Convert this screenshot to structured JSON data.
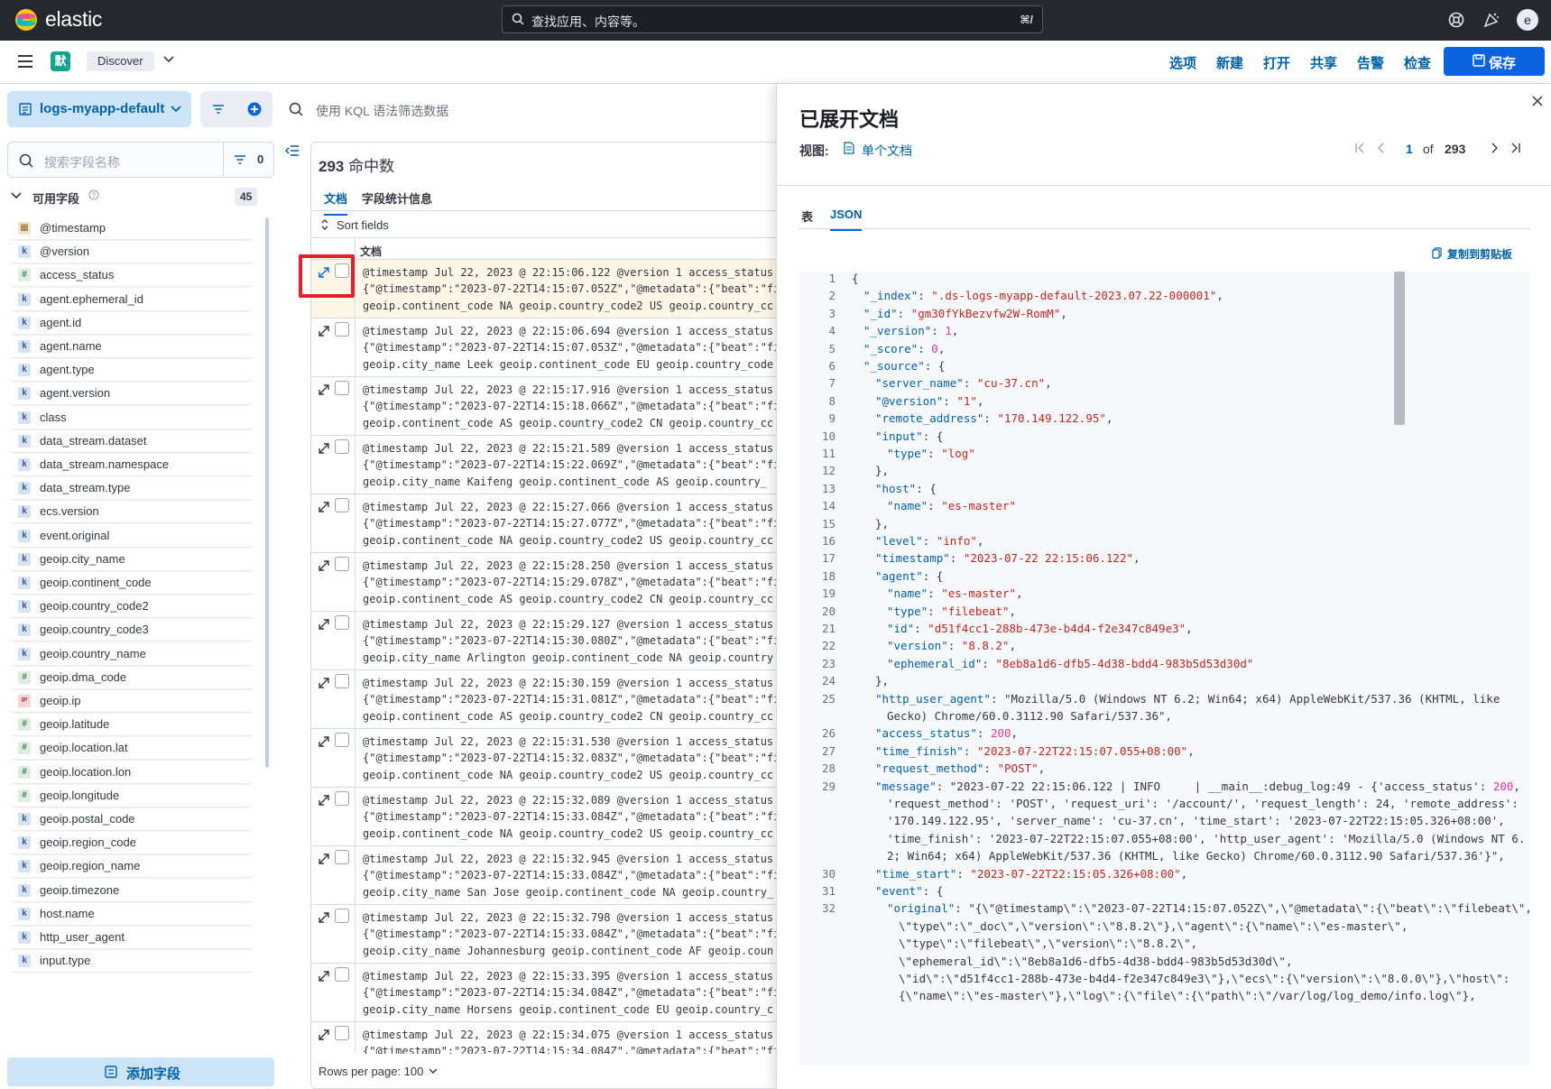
{
  "app": {
    "logo_text": "elastic",
    "search_placeholder": "查找应用、内容等。",
    "search_shortcut": "⌘/",
    "avatar": "e"
  },
  "nav": {
    "space": "默",
    "breadcrumb": "Discover",
    "menu": [
      "选项",
      "新建",
      "打开",
      "共享",
      "告警",
      "检查"
    ],
    "save": "保存"
  },
  "dataview": {
    "name": "logs-myapp-default"
  },
  "kql": {
    "placeholder": "使用 KQL 语法筛选数据"
  },
  "fields": {
    "search_placeholder": "搜索字段名称",
    "filter_count": "0",
    "available_label": "可用字段",
    "available_count": "45",
    "add_label": "添加字段",
    "items": [
      {
        "type": "d",
        "name": "@timestamp"
      },
      {
        "type": "k",
        "name": "@version"
      },
      {
        "type": "n",
        "name": "access_status"
      },
      {
        "type": "k",
        "name": "agent.ephemeral_id"
      },
      {
        "type": "k",
        "name": "agent.id"
      },
      {
        "type": "k",
        "name": "agent.name"
      },
      {
        "type": "k",
        "name": "agent.type"
      },
      {
        "type": "k",
        "name": "agent.version"
      },
      {
        "type": "k",
        "name": "class"
      },
      {
        "type": "k",
        "name": "data_stream.dataset"
      },
      {
        "type": "k",
        "name": "data_stream.namespace"
      },
      {
        "type": "k",
        "name": "data_stream.type"
      },
      {
        "type": "k",
        "name": "ecs.version"
      },
      {
        "type": "k",
        "name": "event.original"
      },
      {
        "type": "k",
        "name": "geoip.city_name"
      },
      {
        "type": "k",
        "name": "geoip.continent_code"
      },
      {
        "type": "k",
        "name": "geoip.country_code2"
      },
      {
        "type": "k",
        "name": "geoip.country_code3"
      },
      {
        "type": "k",
        "name": "geoip.country_name"
      },
      {
        "type": "n",
        "name": "geoip.dma_code"
      },
      {
        "type": "ip",
        "name": "geoip.ip"
      },
      {
        "type": "n",
        "name": "geoip.latitude"
      },
      {
        "type": "n",
        "name": "geoip.location.lat"
      },
      {
        "type": "n",
        "name": "geoip.location.lon"
      },
      {
        "type": "n",
        "name": "geoip.longitude"
      },
      {
        "type": "k",
        "name": "geoip.postal_code"
      },
      {
        "type": "k",
        "name": "geoip.region_code"
      },
      {
        "type": "k",
        "name": "geoip.region_name"
      },
      {
        "type": "k",
        "name": "geoip.timezone"
      },
      {
        "type": "k",
        "name": "host.name"
      },
      {
        "type": "k",
        "name": "http_user_agent"
      },
      {
        "type": "k",
        "name": "input.type"
      }
    ]
  },
  "main": {
    "hits_count": "293",
    "hits_label": "命中数",
    "tab_docs": "文档",
    "tab_stats": "字段统计信息",
    "sort_label": "Sort fields",
    "col_doc": "文档",
    "rows_per_page": "Rows per page: 100",
    "rows": [
      {
        "l1": "@timestamp Jul 22, 2023 @ 22:15:06.122 @version 1 access_status",
        "l2": "{\"@timestamp\":\"2023-07-22T14:15:07.052Z\",\"@metadata\":{\"beat\":\"fi",
        "l3": " geoip.continent_code NA geoip.country_code2 US geoip.country_cc"
      },
      {
        "l1": "@timestamp Jul 22, 2023 @ 22:15:06.694 @version 1 access_status",
        "l2": "{\"@timestamp\":\"2023-07-22T14:15:07.053Z\",\"@metadata\":{\"beat\":\"fi",
        "l3": " geoip.city_name Leek geoip.continent_code EU geoip.country_code"
      },
      {
        "l1": "@timestamp Jul 22, 2023 @ 22:15:17.916 @version 1 access_status",
        "l2": "{\"@timestamp\":\"2023-07-22T14:15:18.066Z\",\"@metadata\":{\"beat\":\"fi",
        "l3": " geoip.continent_code AS geoip.country_code2 CN geoip.country_cc"
      },
      {
        "l1": "@timestamp Jul 22, 2023 @ 22:15:21.589 @version 1 access_status",
        "l2": "{\"@timestamp\":\"2023-07-22T14:15:22.069Z\",\"@metadata\":{\"beat\":\"fi",
        "l3": " geoip.city_name Kaifeng geoip.continent_code AS geoip.country_"
      },
      {
        "l1": "@timestamp Jul 22, 2023 @ 22:15:27.066 @version 1 access_status",
        "l2": "{\"@timestamp\":\"2023-07-22T14:15:27.077Z\",\"@metadata\":{\"beat\":\"fi",
        "l3": " geoip.continent_code NA geoip.country_code2 US geoip.country_cc"
      },
      {
        "l1": "@timestamp Jul 22, 2023 @ 22:15:28.250 @version 1 access_status",
        "l2": "{\"@timestamp\":\"2023-07-22T14:15:29.078Z\",\"@metadata\":{\"beat\":\"fi",
        "l3": " geoip.continent_code AS geoip.country_code2 CN geoip.country_cc"
      },
      {
        "l1": "@timestamp Jul 22, 2023 @ 22:15:29.127 @version 1 access_status",
        "l2": "{\"@timestamp\":\"2023-07-22T14:15:30.080Z\",\"@metadata\":{\"beat\":\"fi",
        "l3": " geoip.city_name Arlington geoip.continent_code NA geoip.country"
      },
      {
        "l1": "@timestamp Jul 22, 2023 @ 22:15:30.159 @version 1 access_status",
        "l2": "{\"@timestamp\":\"2023-07-22T14:15:31.081Z\",\"@metadata\":{\"beat\":\"fi",
        "l3": " geoip.continent_code AS geoip.country_code2 CN geoip.country_cc"
      },
      {
        "l1": "@timestamp Jul 22, 2023 @ 22:15:31.530 @version 1 access_status",
        "l2": "{\"@timestamp\":\"2023-07-22T14:15:32.083Z\",\"@metadata\":{\"beat\":\"fi",
        "l3": " geoip.continent_code NA geoip.country_code2 US geoip.country_cc"
      },
      {
        "l1": "@timestamp Jul 22, 2023 @ 22:15:32.089 @version 1 access_status",
        "l2": "{\"@timestamp\":\"2023-07-22T14:15:33.084Z\",\"@metadata\":{\"beat\":\"fi",
        "l3": " geoip.continent_code NA geoip.country_code2 US geoip.country_cc"
      },
      {
        "l1": "@timestamp Jul 22, 2023 @ 22:15:32.945 @version 1 access_status",
        "l2": "{\"@timestamp\":\"2023-07-22T14:15:33.084Z\",\"@metadata\":{\"beat\":\"fi",
        "l3": " geoip.city_name San Jose geoip.continent_code NA geoip.country_"
      },
      {
        "l1": "@timestamp Jul 22, 2023 @ 22:15:32.798 @version 1 access_status",
        "l2": "{\"@timestamp\":\"2023-07-22T14:15:33.084Z\",\"@metadata\":{\"beat\":\"fi",
        "l3": " geoip.city_name Johannesburg geoip.continent_code AF geoip.coun"
      },
      {
        "l1": "@timestamp Jul 22, 2023 @ 22:15:33.395 @version 1 access_status",
        "l2": "{\"@timestamp\":\"2023-07-22T14:15:34.084Z\",\"@metadata\":{\"beat\":\"fi",
        "l3": " geoip.city_name Horsens geoip.continent_code EU geoip.country_c"
      },
      {
        "l1": "@timestamp Jul 22, 2023 @ 22:15:34.075 @version 1 access_status",
        "l2": "{\"@timestamp\":\"2023-07-22T14:15:34.084Z\",\"@metadata\":{\"beat\":\"fi",
        "l3": ""
      }
    ]
  },
  "flyout": {
    "title": "已展开文档",
    "view_label": "视图:",
    "view_link": "单个文档",
    "page_current": "1",
    "page_of": "of",
    "page_total": "293",
    "tab_table": "表",
    "tab_json": "JSON",
    "copy_label": "复制到剪贴板",
    "json_lines": [
      {
        "n": "1",
        "i": 0,
        "t": "{"
      },
      {
        "n": "2",
        "i": 1,
        "t": "\"_index\": \".ds-logs-myapp-default-2023.07.22-000001\","
      },
      {
        "n": "3",
        "i": 1,
        "t": "\"_id\": \"gm30fYkBezvfw2W-RomM\","
      },
      {
        "n": "4",
        "i": 1,
        "t": "\"_version\": 1,"
      },
      {
        "n": "5",
        "i": 1,
        "t": "\"_score\": 0,"
      },
      {
        "n": "6",
        "i": 1,
        "t": "\"_source\": {"
      },
      {
        "n": "7",
        "i": 2,
        "t": "\"server_name\": \"cu-37.cn\","
      },
      {
        "n": "8",
        "i": 2,
        "t": "\"@version\": \"1\","
      },
      {
        "n": "9",
        "i": 2,
        "t": "\"remote_address\": \"170.149.122.95\","
      },
      {
        "n": "10",
        "i": 2,
        "t": "\"input\": {"
      },
      {
        "n": "11",
        "i": 3,
        "t": "\"type\": \"log\""
      },
      {
        "n": "12",
        "i": 2,
        "t": "},"
      },
      {
        "n": "13",
        "i": 2,
        "t": "\"host\": {"
      },
      {
        "n": "14",
        "i": 3,
        "t": "\"name\": \"es-master\""
      },
      {
        "n": "15",
        "i": 2,
        "t": "},"
      },
      {
        "n": "16",
        "i": 2,
        "t": "\"level\": \"info\","
      },
      {
        "n": "17",
        "i": 2,
        "t": "\"timestamp\": \"2023-07-22 22:15:06.122\","
      },
      {
        "n": "18",
        "i": 2,
        "t": "\"agent\": {"
      },
      {
        "n": "19",
        "i": 3,
        "t": "\"name\": \"es-master\","
      },
      {
        "n": "20",
        "i": 3,
        "t": "\"type\": \"filebeat\","
      },
      {
        "n": "21",
        "i": 3,
        "t": "\"id\": \"d51f4cc1-288b-473e-b4d4-f2e347c849e3\","
      },
      {
        "n": "22",
        "i": 3,
        "t": "\"version\": \"8.8.2\","
      },
      {
        "n": "23",
        "i": 3,
        "t": "\"ephemeral_id\": \"8eb8a1d6-dfb5-4d38-bdd4-983b5d53d30d\""
      },
      {
        "n": "24",
        "i": 2,
        "t": "},"
      },
      {
        "n": "25",
        "i": 2,
        "t": "\"http_user_agent\": \"Mozilla/5.0 (Windows NT 6.2; Win64; x64) AppleWebKit/537.36 (KHTML, like"
      },
      {
        "n": "",
        "i": 3,
        "t": "Gecko) Chrome/60.0.3112.90 Safari/537.36\","
      },
      {
        "n": "26",
        "i": 2,
        "t": "\"access_status\": 200,"
      },
      {
        "n": "27",
        "i": 2,
        "t": "\"time_finish\": \"2023-07-22T22:15:07.055+08:00\","
      },
      {
        "n": "28",
        "i": 2,
        "t": "\"request_method\": \"POST\","
      },
      {
        "n": "29",
        "i": 2,
        "t": "\"message\": \"2023-07-22 22:15:06.122 | INFO     | __main__:debug_log:49 - {'access_status': 200,"
      },
      {
        "n": "",
        "i": 3,
        "t": "'request_method': 'POST', 'request_uri': '/account/', 'request_length': 24, 'remote_address':"
      },
      {
        "n": "",
        "i": 3,
        "t": "'170.149.122.95', 'server_name': 'cu-37.cn', 'time_start': '2023-07-22T22:15:05.326+08:00',"
      },
      {
        "n": "",
        "i": 3,
        "t": "'time_finish': '2023-07-22T22:15:07.055+08:00', 'http_user_agent': 'Mozilla/5.0 (Windows NT 6."
      },
      {
        "n": "",
        "i": 3,
        "t": "2; Win64; x64) AppleWebKit/537.36 (KHTML, like Gecko) Chrome/60.0.3112.90 Safari/537.36'}\","
      },
      {
        "n": "30",
        "i": 2,
        "t": "\"time_start\": \"2023-07-22T22:15:05.326+08:00\","
      },
      {
        "n": "31",
        "i": 2,
        "t": "\"event\": {"
      },
      {
        "n": "32",
        "i": 3,
        "t": "\"original\": \"{\\\"@timestamp\\\":\\\"2023-07-22T14:15:07.052Z\\\",\\\"@metadata\\\":{\\\"beat\\\":\\\"filebeat\\\","
      },
      {
        "n": "",
        "i": 4,
        "t": "\\\"type\\\":\\\"_doc\\\",\\\"version\\\":\\\"8.8.2\\\"},\\\"agent\\\":{\\\"name\\\":\\\"es-master\\\","
      },
      {
        "n": "",
        "i": 4,
        "t": "\\\"type\\\":\\\"filebeat\\\",\\\"version\\\":\\\"8.8.2\\\","
      },
      {
        "n": "",
        "i": 4,
        "t": "\\\"ephemeral_id\\\":\\\"8eb8a1d6-dfb5-4d38-bdd4-983b5d53d30d\\\","
      },
      {
        "n": "",
        "i": 4,
        "t": "\\\"id\\\":\\\"d51f4cc1-288b-473e-b4d4-f2e347c849e3\\\"},\\\"ecs\\\":{\\\"version\\\":\\\"8.0.0\\\"},\\\"host\\\":"
      },
      {
        "n": "",
        "i": 4,
        "t": "{\\\"name\\\":\\\"es-master\\\"},\\\"log\\\":{\\\"file\\\":{\\\"path\\\":\\\"/var/log/log_demo/info.log\\\"},"
      }
    ]
  }
}
